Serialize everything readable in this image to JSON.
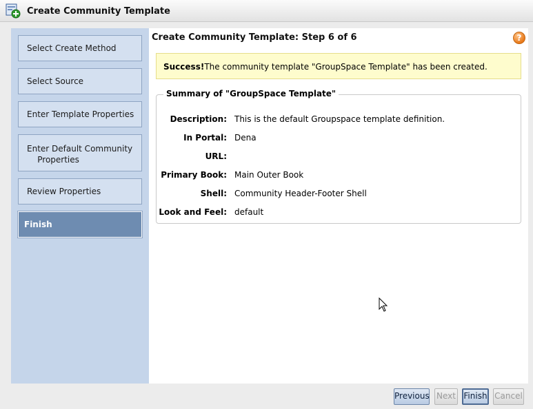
{
  "window": {
    "title": "Create Community Template",
    "icon": "template-add-icon"
  },
  "steps": [
    {
      "label": "Select Create Method",
      "active": false
    },
    {
      "label": "Select Source",
      "active": false
    },
    {
      "label": "Enter Template Properties",
      "active": false
    },
    {
      "label": "Enter Default Community\n    Properties",
      "active": false
    },
    {
      "label": "Review Properties",
      "active": false
    },
    {
      "label": "Finish",
      "active": true
    }
  ],
  "main": {
    "heading": "Create Community Template: Step 6 of 6",
    "help_icon": "help-icon",
    "help_glyph": "?",
    "success": {
      "prefix": "Success!",
      "message": "The community template \"GroupSpace Template\" has been created."
    },
    "summary": {
      "title": "Summary of \"GroupSpace Template\"",
      "fields": [
        {
          "label": "Description:",
          "value": "This is the default Groupspace template definition."
        },
        {
          "label": "In Portal:",
          "value": "Dena"
        },
        {
          "label": "URL:",
          "value": ""
        },
        {
          "label": "Primary Book:",
          "value": "Main Outer Book"
        },
        {
          "label": "Shell:",
          "value": "Community Header-Footer Shell"
        },
        {
          "label": "Look and Feel:",
          "value": "default"
        }
      ]
    }
  },
  "buttons": {
    "previous": "Previous",
    "next": "Next",
    "finish": "Finish",
    "cancel": "Cancel"
  },
  "colors": {
    "sidebar_bg": "#c5d5ea",
    "step_active": "#6e8cb1",
    "success_bg": "#fefccd",
    "help_orange": "#e8791a"
  }
}
